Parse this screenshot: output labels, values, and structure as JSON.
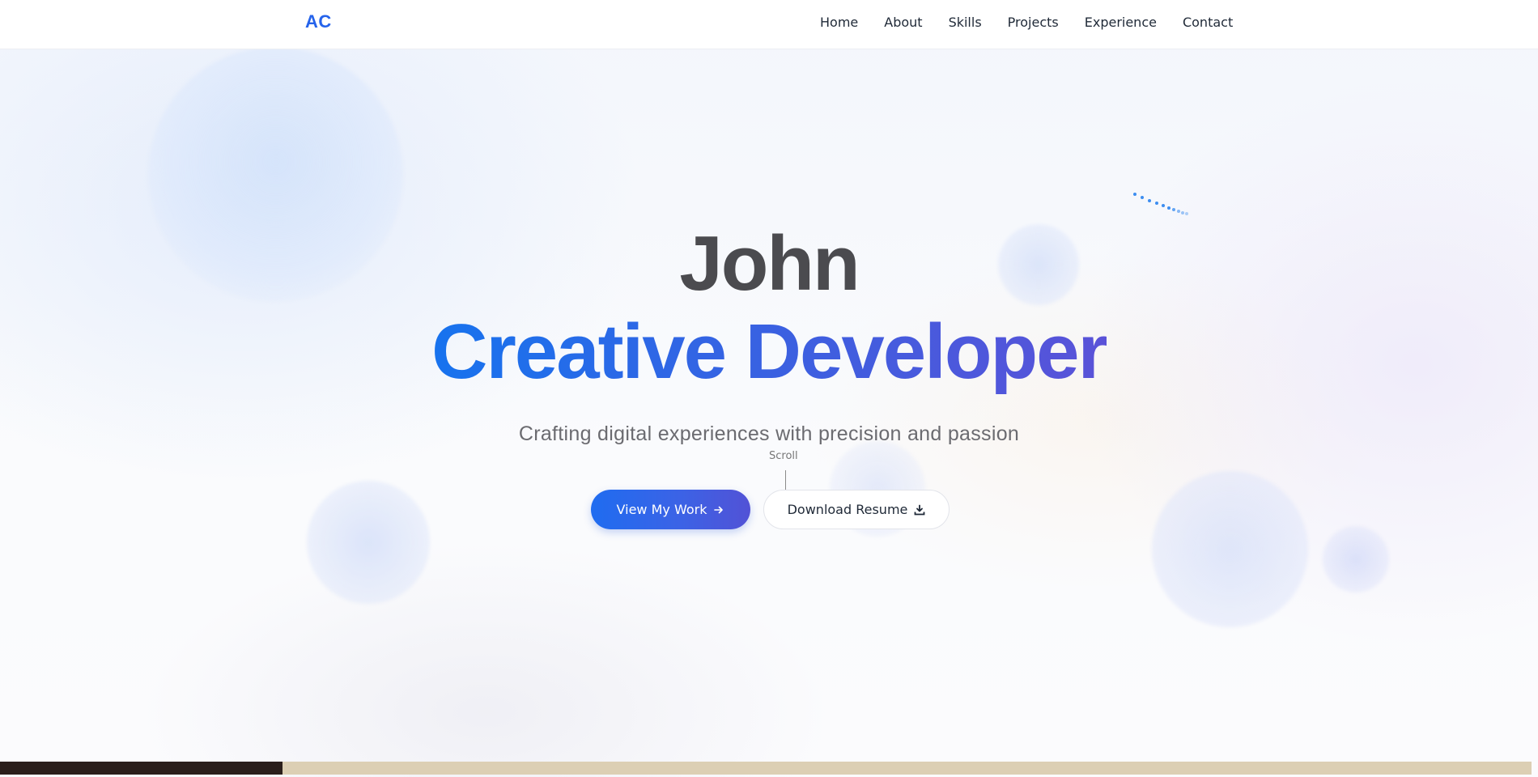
{
  "header": {
    "logo": "AC",
    "nav": [
      "Home",
      "About",
      "Skills",
      "Projects",
      "Experience",
      "Contact"
    ]
  },
  "hero": {
    "name": "John",
    "title": "Creative Developer",
    "tagline": "Crafting digital experiences with precision and passion",
    "scroll_label": "Scroll",
    "primary_button": {
      "label": "View My Work",
      "icon": "arrow-right-icon"
    },
    "secondary_button": {
      "label": "Download Resume",
      "icon": "download-icon"
    }
  },
  "colors": {
    "accent": "#2563eb",
    "gradient_start": "#1773ee",
    "gradient_end": "#5a52d8",
    "name_text": "#4b4b4f"
  }
}
